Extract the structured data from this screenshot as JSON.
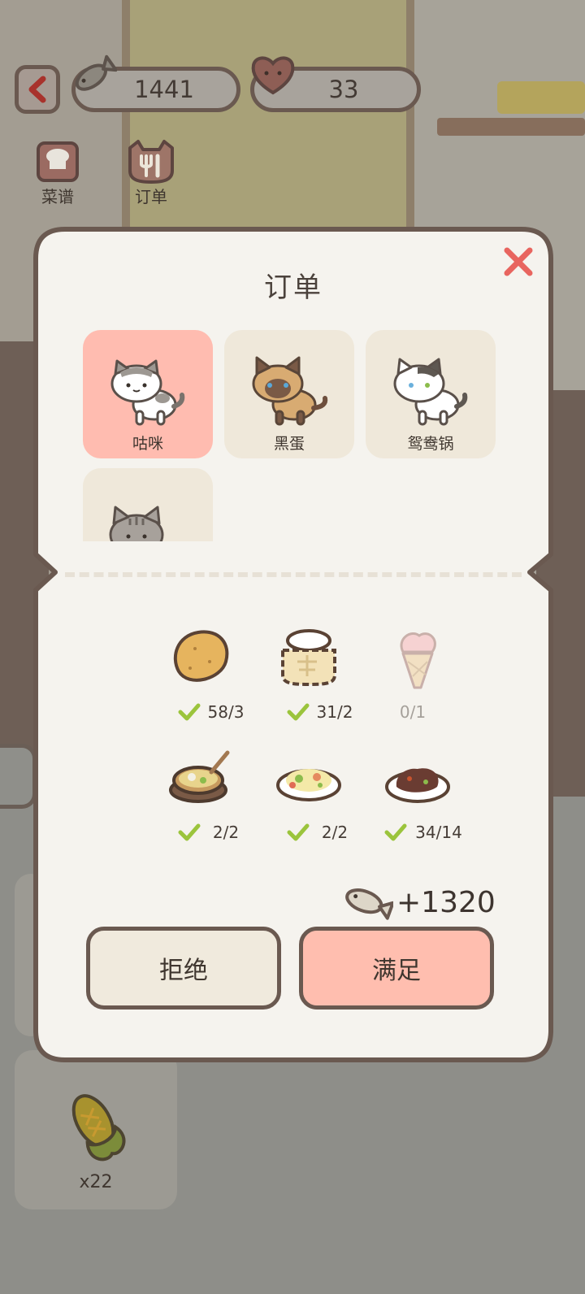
{
  "topbar": {
    "fish_count": "1441",
    "heart_count": "33"
  },
  "nav": {
    "recipe_label": "菜谱",
    "order_label": "订单"
  },
  "modal": {
    "title": "订单",
    "cats": [
      {
        "name": "咕咪",
        "selected": true
      },
      {
        "name": "黑蛋",
        "selected": false
      },
      {
        "name": "鸳鸯锅",
        "selected": false
      },
      {
        "name": "",
        "selected": false
      }
    ],
    "items": [
      {
        "food": "potato-icon",
        "count": "58/3",
        "met": true
      },
      {
        "food": "flour-sack-icon",
        "count": "31/2",
        "met": true
      },
      {
        "food": "ice-cream-icon",
        "count": "0/1",
        "met": false
      },
      {
        "food": "stew-pot-icon",
        "count": "2/2",
        "met": true
      },
      {
        "food": "fried-rice-icon",
        "count": "2/2",
        "met": true
      },
      {
        "food": "braised-meat-icon",
        "count": "34/14",
        "met": true
      }
    ],
    "reward": "+1320",
    "reject_label": "拒绝",
    "accept_label": "满足"
  },
  "inventory": {
    "corn_count": "x22"
  },
  "colors": {
    "selected_card": "#ffbcb0",
    "accept_button": "#ffbeaf",
    "check_green": "#9bc43c",
    "close_red": "#e8655f"
  }
}
